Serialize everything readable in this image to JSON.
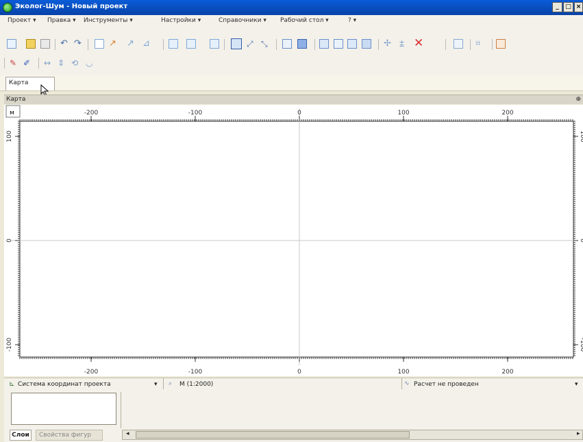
{
  "window": {
    "title": "Эколог-Шум - Новый проект",
    "controls": [
      "_",
      "□",
      "×"
    ]
  },
  "menu": [
    "Проект ▾",
    "Правка ▾",
    "Инструменты ▾",
    "Настройки ▾",
    "Справочники ▾",
    "Рабочий стол ▾",
    "? ▾"
  ],
  "tabs": [
    {
      "label": "Карта",
      "active": true
    }
  ],
  "panel": {
    "title": "Карта",
    "pin": "⊕"
  },
  "ruler": {
    "corner": "м",
    "top_labels": [
      {
        "text": "-200",
        "value": -200
      },
      {
        "text": "-100",
        "value": -100
      },
      {
        "text": "0",
        "value": 0
      },
      {
        "text": "100",
        "value": 100
      },
      {
        "text": "200",
        "value": 200
      }
    ],
    "left_labels": [
      {
        "text": "100",
        "value": 100
      },
      {
        "text": "0",
        "value": 0
      },
      {
        "text": "-100",
        "value": -100
      }
    ]
  },
  "statusbar": {
    "coord_system": "Система координат проекта",
    "scale": "М (1:2000)",
    "calc_status": "Расчет не проведен"
  },
  "bottom_tabs": [
    {
      "label": "Слои",
      "active": true
    },
    {
      "label": "Свойства фигур",
      "active": false
    }
  ],
  "colors": {
    "title_bar": "#0a5cd8",
    "chrome": "#ece9d8",
    "delete_icon": "#d83030",
    "canvas": "#ffffff"
  }
}
